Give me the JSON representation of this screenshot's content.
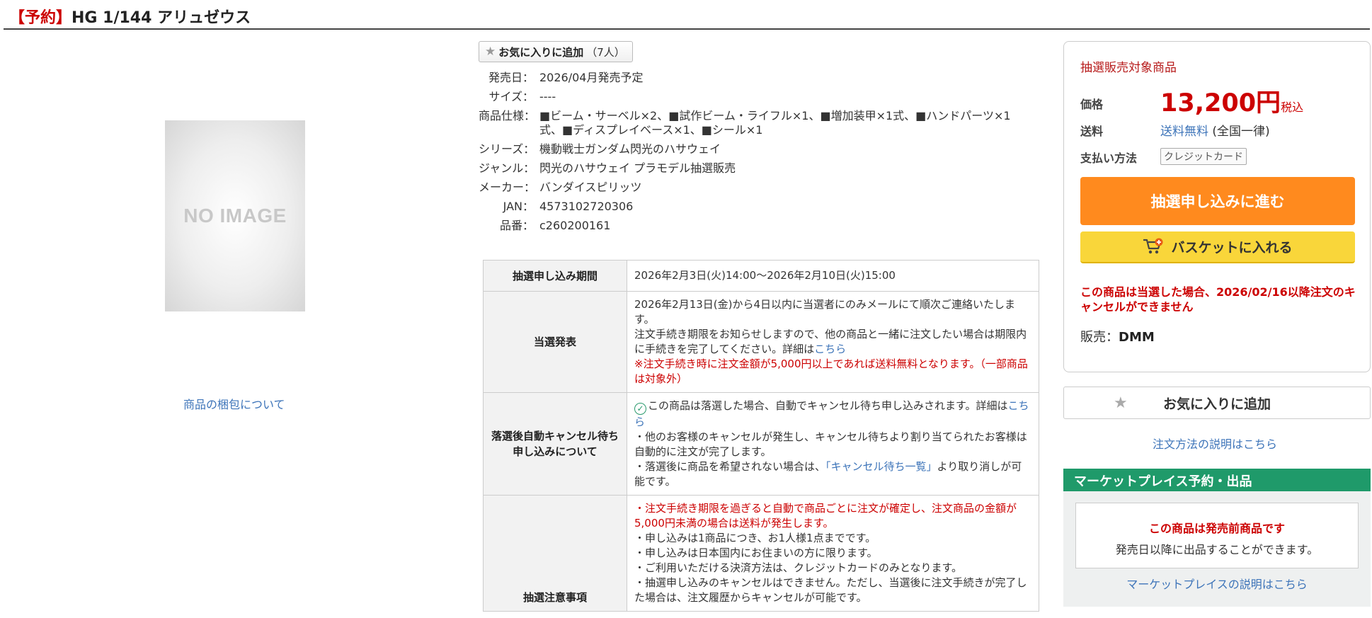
{
  "title": {
    "prefix": "【予約】",
    "name": "HG 1/144 アリュゼウス"
  },
  "image": {
    "placeholder": "NO IMAGE",
    "packing_link": "商品の梱包について"
  },
  "favorite": {
    "label": "お気に入りに追加",
    "count": "（7人）"
  },
  "specs": [
    {
      "key": "発売日：",
      "value": "2026/04月発売予定",
      "link": false
    },
    {
      "key": "サイズ：",
      "value": "----",
      "link": false
    },
    {
      "key": "商品仕様：",
      "value": "■ビーム・サーベル×2、■試作ビーム・ライフル×1、■増加装甲×1式、■ハンドパーツ×1式、■ディスプレイベース×1、■シール×1",
      "link": false
    },
    {
      "key": "シリーズ：",
      "value": "機動戦士ガンダム閃光のハサウェイ",
      "link": true
    },
    {
      "key": "ジャンル：",
      "value": "閃光のハサウェイ プラモデル抽選販売",
      "link": true
    },
    {
      "key": "メーカー：",
      "value": "バンダイスピリッツ",
      "link": true
    },
    {
      "key": "JAN：",
      "value": "4573102720306",
      "link": false
    },
    {
      "key": "品番：",
      "value": "c260200161",
      "link": false
    }
  ],
  "lottery": {
    "period_label": "抽選申し込み期間",
    "period_value": "2026年2月3日(火)14:00～2026年2月10日(火)15:00",
    "announce_label": "当選発表",
    "announce_text1": "2026年2月13日(金)から4日以内に当選者にのみメールにて順次ご連絡いたします。",
    "announce_text2": "注文手続き期限をお知らせしますので、他の商品と一緒に注文したい場合は期限内に手続きを完了してください。詳細は",
    "announce_link": "こちら",
    "announce_red": "※注文手続き時に注文金額が5,000円以上であれば送料無料となります。（一部商品は対象外）",
    "cancel_label": "落選後自動キャンセル待ち申し込みについて",
    "cancel_text1": "この商品は落選した場合、自動でキャンセル待ち申し込みされます。詳細は",
    "cancel_link": "こちら",
    "cancel_text2": "・他のお客様のキャンセルが発生し、キャンセル待ちより割り当てられたお客様は自動的に注文が完了します。",
    "cancel_text3a": "・落選後に商品を希望されない場合は、",
    "cancel_text3_link": "「キャンセル待ち一覧」",
    "cancel_text3b": "より取り消しが可能です。",
    "notes_label": "抽選注意事項",
    "notes_red": "・注文手続き期限を過ぎると自動で商品ごとに注文が確定し、注文商品の金額が5,000円未満の場合は送料が発生します。",
    "notes": [
      "・申し込みは1商品につき、お1人様1点までです。",
      "・申し込みは日本国内にお住まいの方に限ります。",
      "・ご利用いただける決済方法は、クレジットカードのみとなります。",
      "・抽選申し込みのキャンセルはできません。ただし、当選後に注文手続きが完了した場合は、注文履歴からキャンセルが可能です。"
    ]
  },
  "buybox": {
    "title": "抽選販売対象商品",
    "price_label": "価格",
    "price": "13,200円",
    "tax": "税込",
    "shipping_label": "送料",
    "shipping_link": "送料無料",
    "shipping_note": "(全国一律)",
    "payment_label": "支払い方法",
    "payment_tag": "クレジットカード",
    "lottery_button": "抽選申し込みに進む",
    "basket_button": "バスケットに入れる",
    "warning": "この商品は当選した場合、2026/02/16以降注文のキャンセルができません",
    "seller_label": "販売：",
    "seller": "DMM"
  },
  "right_fav": "お気に入りに追加",
  "order_help": "注文方法の説明はこちら",
  "marketplace": {
    "heading": "マーケットプレイス予約・出品",
    "line1": "この商品は発売前商品です",
    "line2": "発売日以降に出品することができます。",
    "link": "マーケットプレイスの説明はこちら"
  },
  "colors": {
    "accent_red": "#cc0000",
    "orange_button": "#ff8a1e",
    "yellow_button": "#f9d63a",
    "green_header": "#1f9a6a",
    "link": "#3d74b9"
  }
}
